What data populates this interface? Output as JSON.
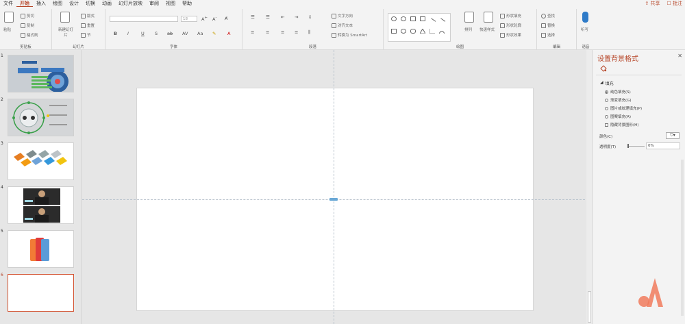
{
  "menu": {
    "tabs": [
      "文件",
      "开始",
      "插入",
      "绘图",
      "设计",
      "切换",
      "动画",
      "幻灯片放映",
      "审阅",
      "视图",
      "帮助"
    ],
    "active_tab": "开始",
    "share": "共享",
    "comment": "批注"
  },
  "ribbon": {
    "clipboard": {
      "paste": "粘贴",
      "cut": "剪切",
      "copy": "复制",
      "format_painter": "格式刷",
      "label": "剪贴板"
    },
    "slides": {
      "new_slide": "新建幻灯片",
      "layout": "版式",
      "reset": "重置",
      "section": "节",
      "label": "幻灯片"
    },
    "font": {
      "font_name": "",
      "font_size": "18",
      "bold": "B",
      "italic": "I",
      "underline": "U",
      "strike": "S",
      "spacing": "ab",
      "case": "Aa",
      "label": "字体"
    },
    "paragraph": {
      "text_direction": "文字方向",
      "align_text": "对齐文本",
      "smartart": "转换为 SmartArt",
      "label": "段落"
    },
    "drawing": {
      "arrange": "排列",
      "quick_styles": "快速样式",
      "shape_fill": "形状填充",
      "shape_outline": "形状轮廓",
      "shape_effects": "形状效果",
      "label": "绘图"
    },
    "editing": {
      "find": "查找",
      "replace": "替换",
      "select": "选择",
      "label": "编辑"
    },
    "voice": {
      "dictate": "听写",
      "label": "语音"
    }
  },
  "slides": [
    {
      "num": "1"
    },
    {
      "num": "2"
    },
    {
      "num": "3"
    },
    {
      "num": "4"
    },
    {
      "num": "5"
    },
    {
      "num": "6"
    }
  ],
  "active_slide": "6",
  "format_pane": {
    "title": "设置背景格式",
    "section": "填充",
    "options": [
      "纯色填充(S)",
      "渐变填充(G)",
      "图片或纹理填充(P)",
      "图案填充(A)"
    ],
    "selected_option": "纯色填充(S)",
    "hide_background": "隐藏背景图形(H)",
    "color_label": "颜色(C)",
    "transparency_label": "透明度(T)",
    "transparency_value": "0%"
  },
  "colors": {
    "accent": "#b7472a",
    "active_border": "#d35230",
    "guide": "#b8c2cc",
    "watermark": "#f07a5c"
  }
}
